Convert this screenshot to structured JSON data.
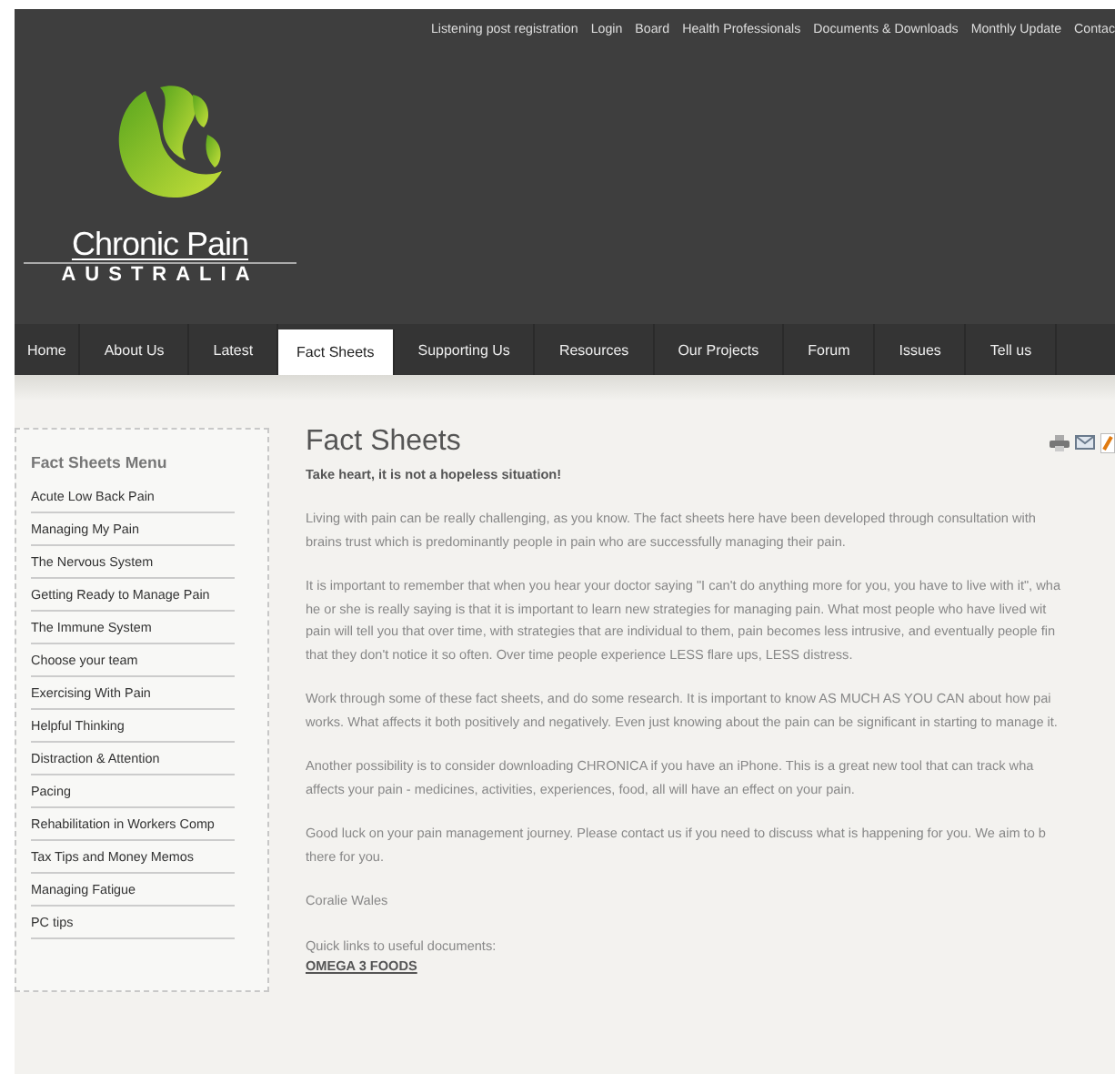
{
  "top_links": [
    "Listening post registration",
    "Login",
    "Board",
    "Health Professionals",
    "Documents & Downloads",
    "Monthly Update",
    "Contac"
  ],
  "logo": {
    "name": "Chronic Pain",
    "subtitle": "AUSTRALIA"
  },
  "nav": [
    {
      "label": "Home",
      "selected": false
    },
    {
      "label": "About Us",
      "selected": false
    },
    {
      "label": "Latest",
      "selected": false
    },
    {
      "label": "Fact Sheets",
      "selected": true
    },
    {
      "label": "Supporting Us",
      "selected": false
    },
    {
      "label": "Resources",
      "selected": false
    },
    {
      "label": "Our Projects",
      "selected": false
    },
    {
      "label": "Forum",
      "selected": false
    },
    {
      "label": "Issues",
      "selected": false
    },
    {
      "label": "Tell us",
      "selected": false
    }
  ],
  "sidebar": {
    "title": "Fact Sheets Menu",
    "items": [
      "Acute Low Back Pain",
      "Managing My Pain",
      "The Nervous System",
      "Getting Ready to Manage Pain",
      "The Immune System",
      "Choose your team",
      "Exercising With Pain",
      "Helpful Thinking",
      "Distraction & Attention",
      "Pacing",
      "Rehabilitation in Workers Comp",
      "Tax Tips and Money Memos",
      "Managing Fatigue",
      "PC tips"
    ]
  },
  "article": {
    "title": "Fact Sheets",
    "lead": "Take heart, it is not a hopeless situation!",
    "paragraphs": [
      [
        "Living with pain can be really challenging, as you know. The fact sheets here have been developed through consultation with",
        "brains trust which is predominantly people in pain who are successfully managing their pain."
      ],
      [
        "It is important to remember that when you hear your doctor saying \"I can't do anything more for you, you have to live with it\", wha",
        "he or she is really saying is that it is important to learn new strategies for managing pain. What most people who have lived wit",
        "pain will tell you that over time, with strategies that are individual to them, pain becomes less intrusive, and eventually people fin",
        "that they don't notice it so often. Over time people experience LESS flare ups, LESS distress."
      ],
      [
        "Work through some of these fact sheets, and do some research. It is important to know AS MUCH AS YOU CAN about how pai",
        "works. What affects it both positively and negatively. Even just knowing about the pain can be significant in starting to manage it."
      ],
      [
        "Another possibility is to consider downloading CHRONICA if you have an iPhone. This is a great new tool that can track wha",
        "affects your pain - medicines, activities, experiences, food, all will have an effect on your pain."
      ],
      [
        "Good luck on your pain management journey. Please contact us if you need to discuss what is happening for you. We aim to b",
        "there for you."
      ],
      [
        "Coralie Wales"
      ]
    ],
    "quick_links_label": "Quick links to useful documents:",
    "quick_links": [
      "OMEGA 3 FOODS"
    ]
  }
}
